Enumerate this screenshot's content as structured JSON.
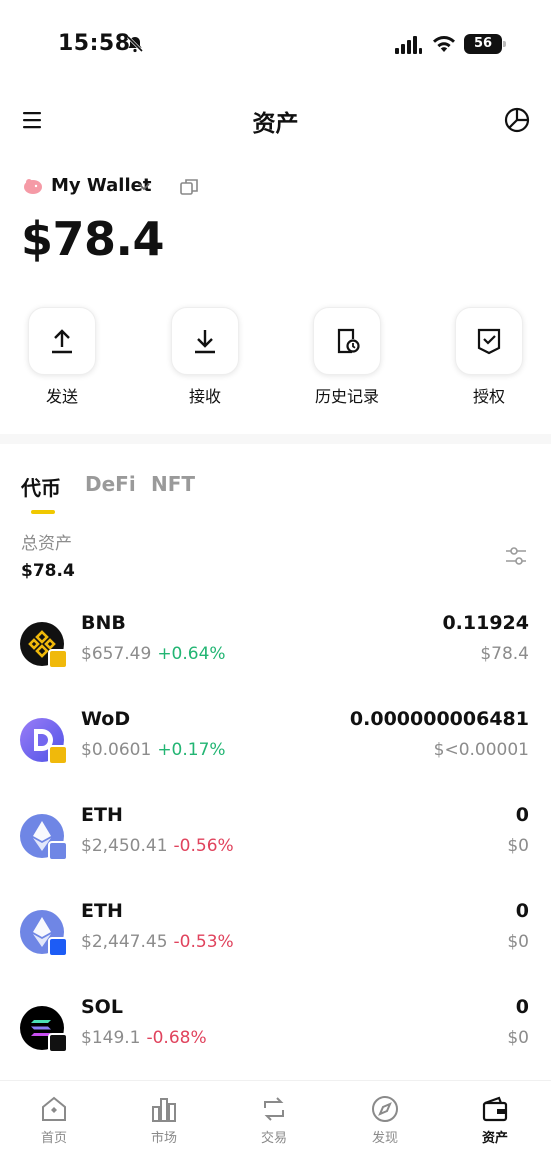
{
  "status_bar": {
    "time": "15:58",
    "battery": "56"
  },
  "header": {
    "title": "资产"
  },
  "wallet": {
    "name": "My Wallet",
    "balance": "$78.4"
  },
  "actions": [
    {
      "label": "发送",
      "icon": "upload-icon"
    },
    {
      "label": "接收",
      "icon": "download-icon"
    },
    {
      "label": "历史记录",
      "icon": "history-icon"
    },
    {
      "label": "授权",
      "icon": "authorize-icon"
    }
  ],
  "tabs": [
    {
      "label": "代币",
      "active": true
    },
    {
      "label": "DeFi",
      "active": false
    },
    {
      "label": "NFT",
      "active": false
    }
  ],
  "summary": {
    "label": "总资产",
    "value": "$78.4"
  },
  "tokens": [
    {
      "symbol": "BNB",
      "price": "$657.49",
      "change": "+0.64%",
      "direction": "up",
      "amount": "0.11924",
      "value": "$78.4",
      "icon_color": "#111111",
      "badge_color": "#f0b90b"
    },
    {
      "symbol": "WoD",
      "price": "$0.0601",
      "change": "+0.17%",
      "direction": "up",
      "amount": "0.000000006481",
      "value": "$<0.00001",
      "icon_color": "#6f5cf0",
      "badge_color": "#f0b90b"
    },
    {
      "symbol": "ETH",
      "price": "$2,450.41",
      "change": "-0.56%",
      "direction": "down",
      "amount": "0",
      "value": "$0",
      "icon_color": "#6f86e5",
      "badge_color": "#6f86e5"
    },
    {
      "symbol": "ETH",
      "price": "$2,447.45",
      "change": "-0.53%",
      "direction": "down",
      "amount": "0",
      "value": "$0",
      "icon_color": "#6f86e5",
      "badge_color": "#1d5cf5"
    },
    {
      "symbol": "SOL",
      "price": "$149.1",
      "change": "-0.68%",
      "direction": "down",
      "amount": "0",
      "value": "$0",
      "icon_color": "#000000",
      "badge_color": "#111111"
    }
  ],
  "bottom_nav": [
    {
      "label": "首页",
      "icon": "home-icon",
      "active": false
    },
    {
      "label": "市场",
      "icon": "market-chart-icon",
      "active": false
    },
    {
      "label": "交易",
      "icon": "swap-icon",
      "active": false
    },
    {
      "label": "发现",
      "icon": "compass-icon",
      "active": false
    },
    {
      "label": "资产",
      "icon": "wallet-icon",
      "active": true
    }
  ],
  "colors": {
    "accent_yellow": "#f0c800",
    "positive": "#22b573",
    "negative": "#e0435d",
    "muted": "#8c8c8c"
  }
}
